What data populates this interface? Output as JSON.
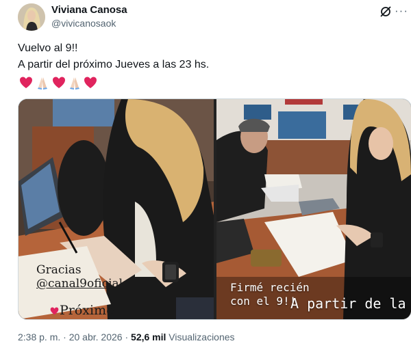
{
  "author": {
    "name": "Viviana Canosa",
    "handle": "@vivicanosaok",
    "avatar_icon": "profile-photo",
    "grok_icon": "grok-icon",
    "more_icon": "more-options-icon"
  },
  "tweet": {
    "lines": [
      "Vuelvo al 9!!",
      "A partir del próximo Jueves a las 23 hs."
    ],
    "emoji": [
      "red-heart",
      "folded-hands",
      "red-heart",
      "folded-hands",
      "red-heart"
    ]
  },
  "media": {
    "left_photo": {
      "caption_line1": "Gracias",
      "caption_line2": "@canal9oficial",
      "caption_line3": "Próximo"
    },
    "right_photo": {
      "story_line1": "Firmé recién",
      "story_line2": "con el 9!!",
      "story_line3": "A partir de la"
    }
  },
  "meta": {
    "time": "2:38 p. m.",
    "sep1": "·",
    "date": "20 abr. 2026",
    "sep2": "·",
    "views_count": "52,6 mil",
    "views_label": "Visualizaciones"
  },
  "colors": {
    "heart": "#e0245e",
    "text_primary": "#0f1419",
    "text_secondary": "#536471",
    "desk": "#b5643a"
  }
}
